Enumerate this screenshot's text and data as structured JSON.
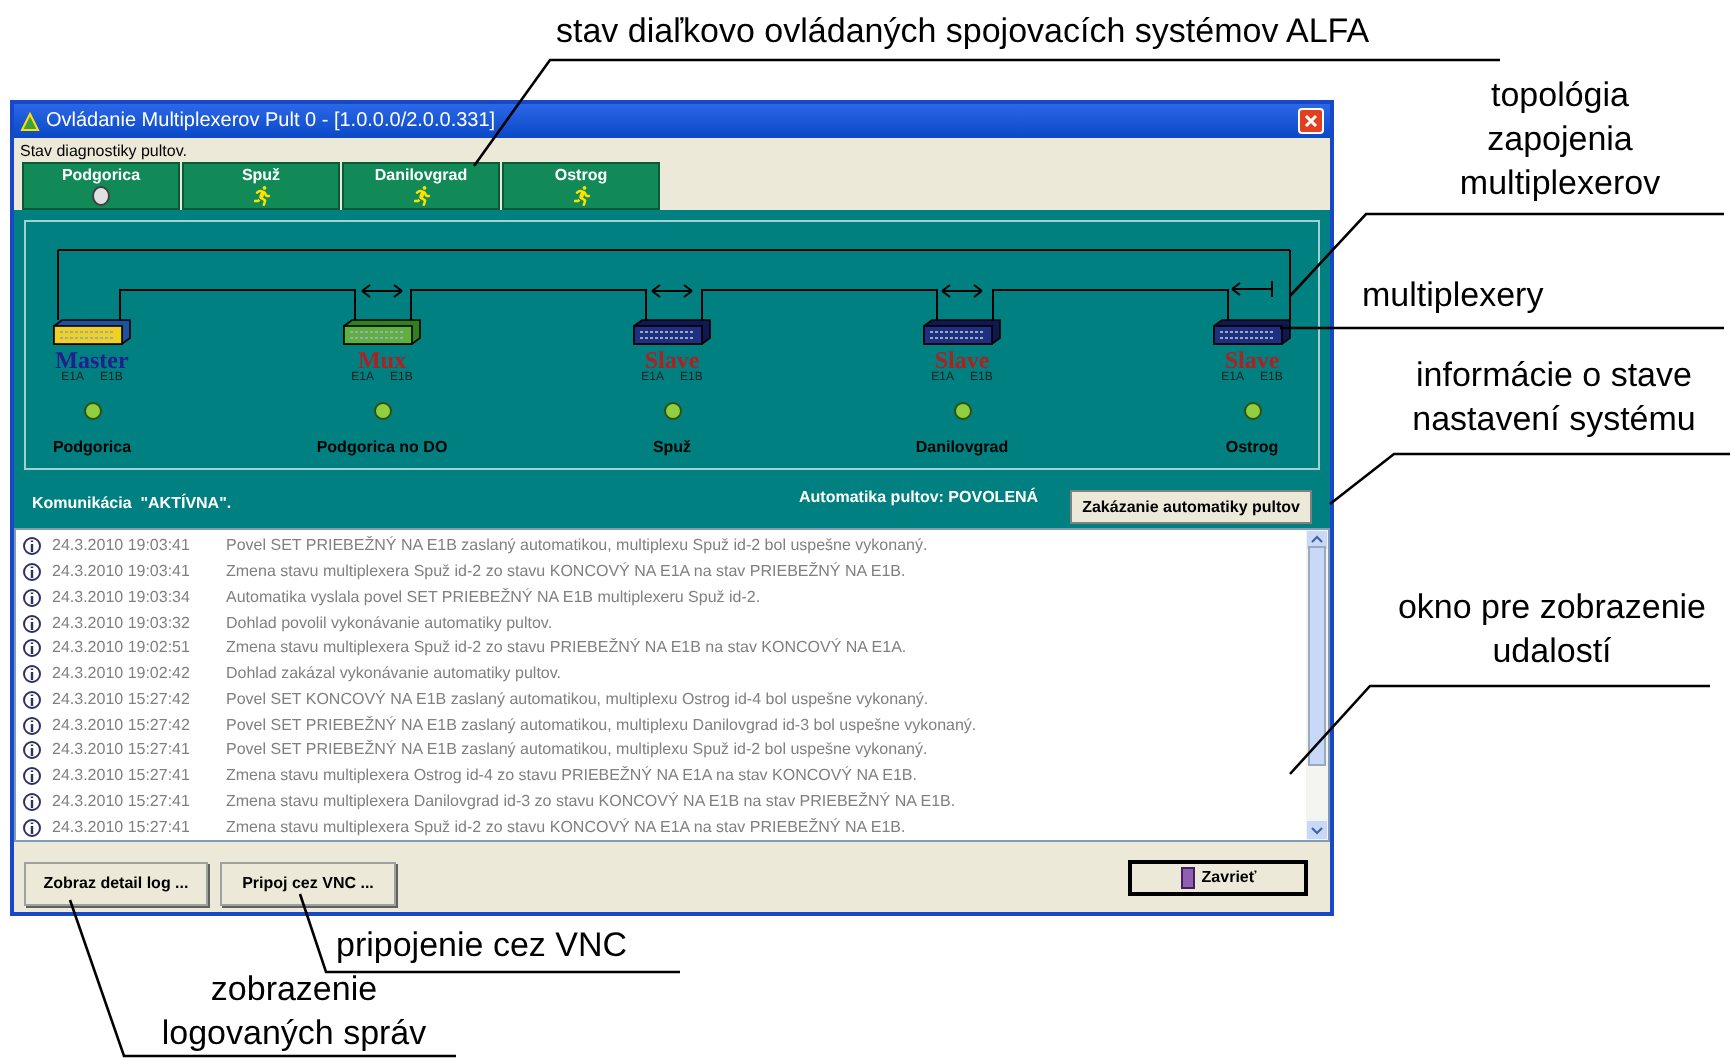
{
  "callouts": {
    "alfa_status": "stav diaľkovo ovládaných spojovacích systémov ALFA",
    "topology": "topológia zapojenia multiplexerov",
    "multiplexers": "multiplexery",
    "system_info": "informácie o stave nastavení systému",
    "event_window": "okno pre zobrazenie udalostí",
    "vnc": "pripojenie cez VNC",
    "log_view": "zobrazenie logovaných správ"
  },
  "window": {
    "title": "Ovládanie Multiplexerov Pult 0 - [1.0.0.0/2.0.0.331]"
  },
  "status_label": "Stav diagnostiky pultov.",
  "consoles": [
    {
      "name": "Podgorica",
      "kind": "disc"
    },
    {
      "name": "Spuž",
      "kind": "runner"
    },
    {
      "name": "Danilovgrad",
      "kind": "runner"
    },
    {
      "name": "Ostrog",
      "kind": "runner"
    }
  ],
  "nodes": [
    {
      "kind": "master",
      "role": "Master",
      "ports": [
        "E1A",
        "E1B"
      ],
      "name": "Podgorica",
      "led_on": true
    },
    {
      "kind": "mux",
      "role": "Mux",
      "ports": [
        "E1A",
        "E1B"
      ],
      "name": "Podgorica no DO",
      "link": {
        "kind": "both"
      },
      "led_on": true
    },
    {
      "kind": "slave",
      "role": "Slave",
      "ports": [
        "E1A",
        "E1B"
      ],
      "name": "Spuž",
      "link": {
        "kind": "both"
      },
      "led_on": true
    },
    {
      "kind": "slave",
      "role": "Slave",
      "ports": [
        "E1A",
        "E1B"
      ],
      "name": "Danilovgrad",
      "link": {
        "kind": "both"
      },
      "led_on": true
    },
    {
      "kind": "slave",
      "role": "Slave",
      "ports": [
        "E1A",
        "E1B"
      ],
      "name": "Ostrog",
      "link": {
        "kind": "end"
      },
      "led_on": true
    }
  ],
  "communication": "Komunikácia  \"AKTÍVNA\".",
  "automation": "Automatika pultov: POVOLENÁ",
  "automation_button": "Zakázanie automatiky pultov",
  "log": [
    {
      "time": "24.3.2010 19:03:41",
      "message": "Povel SET PRIEBEŽNÝ NA E1B zaslaný automatikou, multiplexu Spuž id-2 bol uspešne vykonaný."
    },
    {
      "time": "24.3.2010 19:03:41",
      "message": "Zmena stavu multiplexera Spuž id-2 zo stavu KONCOVÝ NA E1A na stav PRIEBEŽNÝ NA E1B."
    },
    {
      "time": "24.3.2010 19:03:34",
      "message": "Automatika vyslala povel SET PRIEBEŽNÝ NA E1B multiplexeru Spuž id-2."
    },
    {
      "time": "24.3.2010 19:03:32",
      "message": "Dohlad povolil vykonávanie automatiky pultov."
    },
    {
      "time": "24.3.2010 19:02:51",
      "message": "Zmena stavu multiplexera Spuž id-2 zo stavu PRIEBEŽNÝ NA E1B na stav KONCOVÝ NA E1A."
    },
    {
      "time": "24.3.2010 19:02:42",
      "message": "Dohlad zakázal vykonávanie automatiky pultov."
    },
    {
      "time": "24.3.2010 15:27:42",
      "message": "Povel SET KONCOVÝ NA E1B zaslaný automatikou, multiplexu Ostrog id-4 bol uspešne vykonaný."
    },
    {
      "time": "24.3.2010 15:27:42",
      "message": "Povel SET PRIEBEŽNÝ NA E1B zaslaný automatikou, multiplexu Danilovgrad id-3 bol uspešne vykonaný."
    },
    {
      "time": "24.3.2010 15:27:41",
      "message": "Povel SET PRIEBEŽNÝ NA E1B zaslaný automatikou, multiplexu Spuž id-2 bol uspešne vykonaný."
    },
    {
      "time": "24.3.2010 15:27:41",
      "message": "Zmena stavu multiplexera Ostrog id-4 zo stavu PRIEBEŽNÝ NA E1A na stav KONCOVÝ NA E1B."
    },
    {
      "time": "24.3.2010 15:27:41",
      "message": "Zmena stavu multiplexera Danilovgrad id-3 zo stavu KONCOVÝ NA E1B na stav PRIEBEŽNÝ NA E1B."
    },
    {
      "time": "24.3.2010 15:27:41",
      "message": "Zmena stavu multiplexera Spuž id-2 zo stavu KONCOVÝ NA E1A na stav PRIEBEŽNÝ NA E1B."
    }
  ],
  "buttons": {
    "detail_log": "Zobraz detail log ...",
    "vnc": "Pripoj cez VNC ...",
    "close": "Zavrieť"
  }
}
